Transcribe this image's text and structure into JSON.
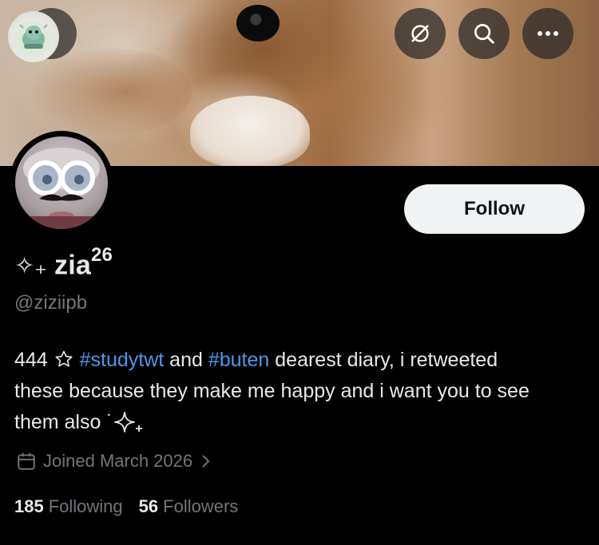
{
  "header": {
    "back_icon": "arrow-left-icon",
    "ring_icon": "slashed-ring-icon",
    "search_icon": "search-icon",
    "more_icon": "more-horizontal-icon"
  },
  "profile": {
    "display_name_prefix": "✧₊",
    "display_name": "zia",
    "display_name_sup": "26",
    "handle": "@ziziipb",
    "follow_label": "Follow",
    "bio": {
      "part1": "444 ",
      "part2": " ",
      "hashtag1": "#studytwt",
      "part3": " and ",
      "hashtag2": "#buten",
      "part4": " dearest diary, i retweeted these because they make me happy and i want you to see them also ˙"
    },
    "joined": "Joined March 2026",
    "following_count": "185",
    "following_label": "Following",
    "followers_count": "56",
    "followers_label": "Followers"
  },
  "colors": {
    "background": "#000000",
    "text_primary": "#e7e9ea",
    "text_secondary": "#71767b",
    "link": "#4a99e9",
    "follow_button_bg": "#eff3f4"
  }
}
